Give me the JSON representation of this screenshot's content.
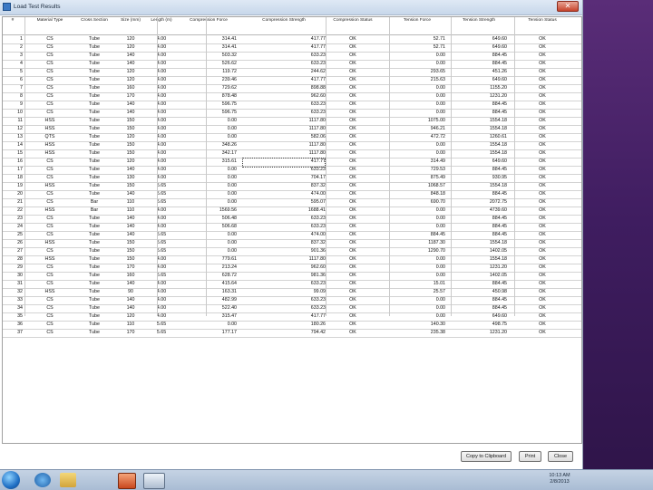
{
  "window": {
    "title": "Load Test Results",
    "close_glyph": "✕"
  },
  "table": {
    "columns": [
      {
        "key": "num",
        "label": "#"
      },
      {
        "key": "mat",
        "label": "Material Type"
      },
      {
        "key": "cs",
        "label": "Cross Section"
      },
      {
        "key": "size",
        "label": "Size (mm)"
      },
      {
        "key": "len",
        "label": "Length (m)"
      },
      {
        "key": "cf",
        "label": "Compression Force"
      },
      {
        "key": "curs",
        "label": "Compression Strength"
      },
      {
        "key": "cst",
        "label": "Compression Status"
      },
      {
        "key": "tf",
        "label": "Tension Force"
      },
      {
        "key": "ts",
        "label": "Tension Strength"
      },
      {
        "key": "tst",
        "label": "Tension Status"
      }
    ],
    "rows": [
      [
        "1",
        "CS",
        "Tube",
        "120",
        "4.00",
        "314.41",
        "417.77",
        "OK",
        "52.71",
        "649.60",
        "OK"
      ],
      [
        "2",
        "CS",
        "Tube",
        "120",
        "4.00",
        "314.41",
        "417.77",
        "OK",
        "52.71",
        "649.60",
        "OK"
      ],
      [
        "3",
        "CS",
        "Tube",
        "140",
        "4.00",
        "503.32",
        "633.23",
        "OK",
        "0.00",
        "884.45",
        "OK"
      ],
      [
        "4",
        "CS",
        "Tube",
        "140",
        "4.00",
        "526.62",
        "633.23",
        "OK",
        "0.00",
        "884.45",
        "OK"
      ],
      [
        "5",
        "CS",
        "Tube",
        "120",
        "4.00",
        "119.72",
        "244.62",
        "OK",
        "293.65",
        "451.26",
        "OK"
      ],
      [
        "6",
        "CS",
        "Tube",
        "120",
        "4.00",
        "239.46",
        "417.77",
        "OK",
        "215.63",
        "649.60",
        "OK"
      ],
      [
        "7",
        "CS",
        "Tube",
        "160",
        "4.00",
        "729.62",
        "898.88",
        "OK",
        "0.00",
        "1155.20",
        "OK"
      ],
      [
        "8",
        "CS",
        "Tube",
        "170",
        "4.00",
        "878.48",
        "962.60",
        "OK",
        "0.00",
        "1231.20",
        "OK"
      ],
      [
        "9",
        "CS",
        "Tube",
        "140",
        "4.00",
        "596.75",
        "633.23",
        "OK",
        "0.00",
        "884.45",
        "OK"
      ],
      [
        "10",
        "CS",
        "Tube",
        "140",
        "4.00",
        "596.75",
        "633.23",
        "OK",
        "0.00",
        "884.45",
        "OK"
      ],
      [
        "11",
        "HSS",
        "Tube",
        "150",
        "4.00",
        "0.00",
        "1117.80",
        "OK",
        "1075.00",
        "1554.18",
        "OK"
      ],
      [
        "12",
        "HSS",
        "Tube",
        "150",
        "4.00",
        "0.00",
        "1117.80",
        "OK",
        "946.21",
        "1554.18",
        "OK"
      ],
      [
        "13",
        "QTS",
        "Tube",
        "120",
        "4.00",
        "0.00",
        "582.06",
        "OK",
        "472.72",
        "1260.61",
        "OK"
      ],
      [
        "14",
        "HSS",
        "Tube",
        "150",
        "4.00",
        "348.26",
        "1117.80",
        "OK",
        "0.00",
        "1554.18",
        "OK"
      ],
      [
        "15",
        "HSS",
        "Tube",
        "150",
        "4.00",
        "342.17",
        "1117.80",
        "OK",
        "0.00",
        "1554.18",
        "OK"
      ],
      [
        "16",
        "CS",
        "Tube",
        "120",
        "4.00",
        "315.61",
        "417.77",
        "OK",
        "314.49",
        "649.60",
        "OK"
      ],
      [
        "17",
        "CS",
        "Tube",
        "140",
        "4.00",
        "0.00",
        "633.23",
        "OK",
        "729.53",
        "884.45",
        "OK"
      ],
      [
        "18",
        "CS",
        "Tube",
        "130",
        "4.00",
        "0.00",
        "704.17",
        "OK",
        "875.49",
        "930.95",
        "OK"
      ],
      [
        "19",
        "HSS",
        "Tube",
        "150",
        "5.65",
        "0.00",
        "837.32",
        "OK",
        "1068.57",
        "1554.18",
        "OK"
      ],
      [
        "20",
        "CS",
        "Tube",
        "140",
        "5.65",
        "0.00",
        "474.00",
        "OK",
        "848.18",
        "884.45",
        "OK"
      ],
      [
        "21",
        "CS",
        "Bar",
        "110",
        "5.65",
        "0.00",
        "595.07",
        "OK",
        "690.70",
        "2072.75",
        "OK"
      ],
      [
        "22",
        "HSS",
        "Bar",
        "110",
        "4.00",
        "1569.56",
        "1688.41",
        "OK",
        "0.00",
        "4739.60",
        "OK"
      ],
      [
        "23",
        "CS",
        "Tube",
        "140",
        "4.00",
        "506.48",
        "633.23",
        "OK",
        "0.00",
        "884.45",
        "OK"
      ],
      [
        "24",
        "CS",
        "Tube",
        "140",
        "4.00",
        "506.68",
        "633.23",
        "OK",
        "0.00",
        "884.45",
        "OK"
      ],
      [
        "25",
        "CS",
        "Tube",
        "140",
        "5.65",
        "0.00",
        "474.00",
        "OK",
        "884.45",
        "884.45",
        "OK"
      ],
      [
        "26",
        "HSS",
        "Tube",
        "150",
        "5.65",
        "0.00",
        "837.32",
        "OK",
        "1187.30",
        "1554.18",
        "OK"
      ],
      [
        "27",
        "CS",
        "Tube",
        "150",
        "5.65",
        "0.00",
        "901.36",
        "OK",
        "1290.70",
        "1402.05",
        "OK"
      ],
      [
        "28",
        "HSS",
        "Tube",
        "150",
        "4.00",
        "779.61",
        "1117.80",
        "OK",
        "0.00",
        "1554.18",
        "OK"
      ],
      [
        "29",
        "CS",
        "Tube",
        "170",
        "4.00",
        "213.24",
        "962.60",
        "OK",
        "0.00",
        "1231.20",
        "OK"
      ],
      [
        "30",
        "CS",
        "Tube",
        "160",
        "5.65",
        "628.72",
        "981.36",
        "OK",
        "0.00",
        "1402.05",
        "OK"
      ],
      [
        "31",
        "CS",
        "Tube",
        "140",
        "4.00",
        "415.64",
        "633.23",
        "OK",
        "15.01",
        "884.45",
        "OK"
      ],
      [
        "32",
        "HSS",
        "Tube",
        "90",
        "4.00",
        "163.31",
        "99.09",
        "OK",
        "25.57",
        "450.98",
        "OK"
      ],
      [
        "33",
        "CS",
        "Tube",
        "140",
        "4.00",
        "482.99",
        "633.23",
        "OK",
        "0.00",
        "884.45",
        "OK"
      ],
      [
        "34",
        "CS",
        "Tube",
        "140",
        "4.00",
        "522.40",
        "633.23",
        "OK",
        "0.00",
        "884.45",
        "OK"
      ],
      [
        "35",
        "CS",
        "Tube",
        "120",
        "4.00",
        "315.47",
        "417.77",
        "OK",
        "0.00",
        "649.60",
        "OK"
      ],
      [
        "36",
        "CS",
        "Tube",
        "110",
        "5.65",
        "0.00",
        "180.26",
        "OK",
        "140.30",
        "498.75",
        "OK"
      ],
      [
        "37",
        "CS",
        "Tube",
        "170",
        "5.65",
        "177.17",
        "794.42",
        "OK",
        "235.38",
        "1231.20",
        "OK"
      ]
    ]
  },
  "buttons": {
    "copy": "Copy to Clipboard",
    "print": "Print",
    "close": "Close"
  },
  "taskbar": {
    "icons": [
      "start-orb-icon",
      "internet-explorer-icon",
      "file-explorer-icon",
      "powerpoint-icon",
      "app-window-icon"
    ],
    "time": "10:13 AM",
    "date": "2/8/2013"
  },
  "colors": {
    "desktop": "#3f1d60",
    "taskbar": "#b6c6da",
    "window_title": "#cfdcec"
  }
}
